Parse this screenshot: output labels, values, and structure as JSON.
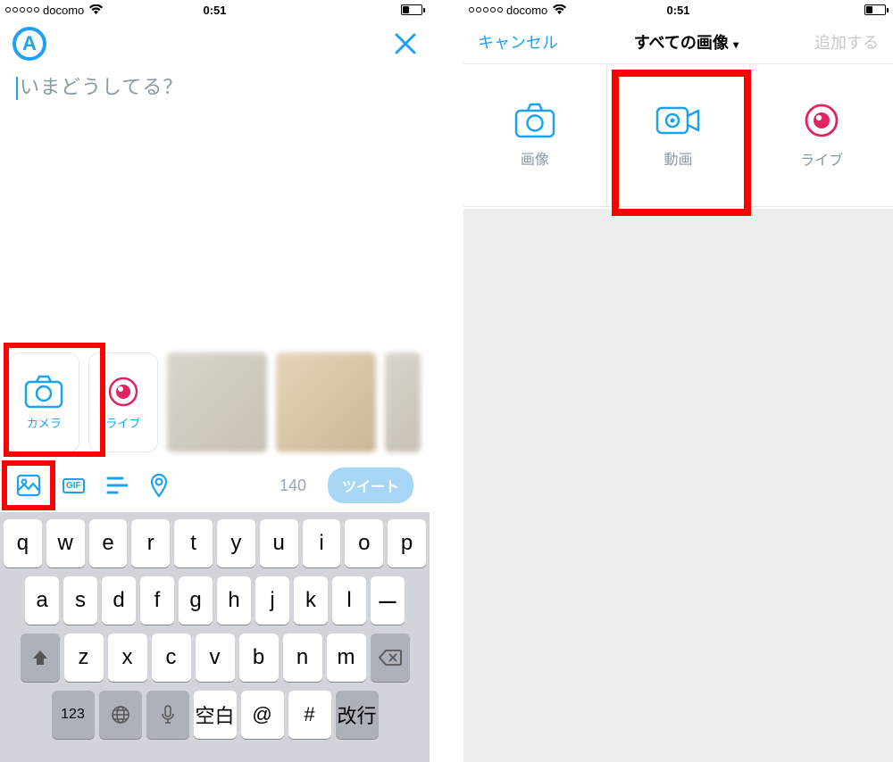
{
  "status": {
    "carrier": "docomo",
    "time": "0:51"
  },
  "compose": {
    "placeholder": "いまどうしてる？",
    "avatar_letter": "A"
  },
  "media_strip": {
    "camera": "カメラ",
    "live": "ライブ"
  },
  "toolbar": {
    "count": "140",
    "tweet": "ツイート",
    "gif_label": "GIF"
  },
  "keyboard": {
    "row1": [
      "q",
      "w",
      "e",
      "r",
      "t",
      "y",
      "u",
      "i",
      "o",
      "p"
    ],
    "row2": [
      "a",
      "s",
      "d",
      "f",
      "g",
      "h",
      "j",
      "k",
      "l",
      "ー"
    ],
    "row3": [
      "z",
      "x",
      "c",
      "v",
      "b",
      "n",
      "m"
    ],
    "num_key": "123",
    "space": "空白",
    "at": "@",
    "hash": "#",
    "enter": "改行"
  },
  "picker": {
    "cancel": "キャンセル",
    "title": "すべての画像",
    "add": "追加する",
    "image": "画像",
    "video": "動画",
    "live": "ライブ"
  },
  "colors": {
    "twitter_blue": "#1DA1F2",
    "highlight_red": "#FF0000",
    "periscope_red": "#E0245E"
  }
}
